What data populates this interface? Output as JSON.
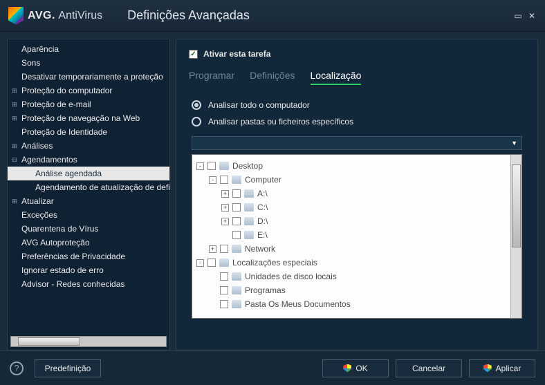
{
  "window": {
    "logo_brand": "AVG.",
    "logo_product": "AntiVirus",
    "title": "Definições Avançadas"
  },
  "sidebar": {
    "items": [
      {
        "label": "Aparência",
        "expandable": false
      },
      {
        "label": "Sons",
        "expandable": false
      },
      {
        "label": "Desativar temporariamente a proteção",
        "expandable": false
      },
      {
        "label": "Proteção do computador",
        "expandable": true
      },
      {
        "label": "Proteção de e-mail",
        "expandable": true
      },
      {
        "label": "Proteção de navegação na Web",
        "expandable": true
      },
      {
        "label": "Proteção de Identidade",
        "expandable": false
      },
      {
        "label": "Análises",
        "expandable": true
      },
      {
        "label": "Agendamentos",
        "expandable": true,
        "expanded": true,
        "children": [
          {
            "label": "Análise agendada",
            "selected": true
          },
          {
            "label": "Agendamento de atualização de definições"
          }
        ]
      },
      {
        "label": "Atualizar",
        "expandable": true
      },
      {
        "label": "Exceções",
        "expandable": false
      },
      {
        "label": "Quarentena de Vírus",
        "expandable": false
      },
      {
        "label": "AVG Autoproteção",
        "expandable": false
      },
      {
        "label": "Preferências de Privacidade",
        "expandable": false
      },
      {
        "label": "Ignorar estado de erro",
        "expandable": false
      },
      {
        "label": "Advisor - Redes conhecidas",
        "expandable": false
      }
    ]
  },
  "main": {
    "enable_label": "Ativar esta tarefa",
    "enable_checked": true,
    "tabs": [
      {
        "label": "Programar"
      },
      {
        "label": "Definições"
      },
      {
        "label": "Localização",
        "active": true
      }
    ],
    "radios": [
      {
        "label": "Analisar todo o computador",
        "checked": true
      },
      {
        "label": "Analisar pastas ou ficheiros específicos",
        "checked": false
      }
    ],
    "tree": [
      {
        "level": 0,
        "toggle": "-",
        "label": "Desktop"
      },
      {
        "level": 1,
        "toggle": "-",
        "label": "Computer"
      },
      {
        "level": 2,
        "toggle": "+",
        "label": "A:\\"
      },
      {
        "level": 2,
        "toggle": "+",
        "label": "C:\\"
      },
      {
        "level": 2,
        "toggle": "+",
        "label": "D:\\"
      },
      {
        "level": 2,
        "toggle": "",
        "label": "E:\\"
      },
      {
        "level": 1,
        "toggle": "+",
        "label": "Network"
      },
      {
        "level": 0,
        "toggle": "-",
        "label": "Localizações especiais"
      },
      {
        "level": 1,
        "toggle": "",
        "label": "Unidades de disco locais"
      },
      {
        "level": 1,
        "toggle": "",
        "label": "Programas"
      },
      {
        "level": 1,
        "toggle": "",
        "label": "Pasta Os Meus Documentos"
      }
    ]
  },
  "footer": {
    "preset": "Predefinição",
    "ok": "OK",
    "cancel": "Cancelar",
    "apply": "Aplicar"
  }
}
